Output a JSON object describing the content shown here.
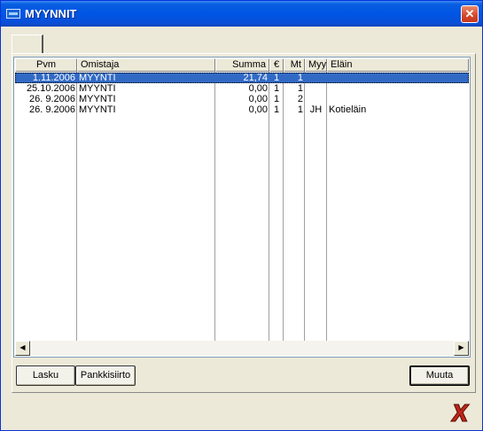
{
  "window": {
    "title": "MYYNNIT",
    "close_glyph": "✕",
    "icon": "app-icon"
  },
  "tabs": [
    {
      "label": ""
    }
  ],
  "columns": [
    "Pvm",
    "Omistaja",
    "Summa",
    "€",
    "Mt",
    "Myy",
    "Eläin"
  ],
  "rows": [
    {
      "pvm": "1.11.2006",
      "omistaja": "MYYNTI",
      "summa": "21,74",
      "euro": "1",
      "mt": "1",
      "myy": "",
      "elain": "",
      "selected": true
    },
    {
      "pvm": "25.10.2006",
      "omistaja": "MYYNTI",
      "summa": "0,00",
      "euro": "1",
      "mt": "1",
      "myy": "",
      "elain": ""
    },
    {
      "pvm": "26. 9.2006",
      "omistaja": "MYYNTI",
      "summa": "0,00",
      "euro": "1",
      "mt": "2",
      "myy": "",
      "elain": ""
    },
    {
      "pvm": "26. 9.2006",
      "omistaja": "MYYNTI",
      "summa": "0,00",
      "euro": "1",
      "mt": "1",
      "myy": "JH",
      "elain": "Kotieläin"
    }
  ],
  "scrollbar": {
    "left_glyph": "◀",
    "right_glyph": "▶"
  },
  "buttons": {
    "lasku": "Lasku",
    "pankkisiirto": "Pankkisiirto",
    "muuta": "Muuta"
  },
  "exit": {
    "icon": "red-x-exit-icon",
    "color": "#c0241a"
  },
  "colors": {
    "selection": "#316ac5",
    "titlebar": "#0055e5",
    "face": "#ece9d8"
  }
}
